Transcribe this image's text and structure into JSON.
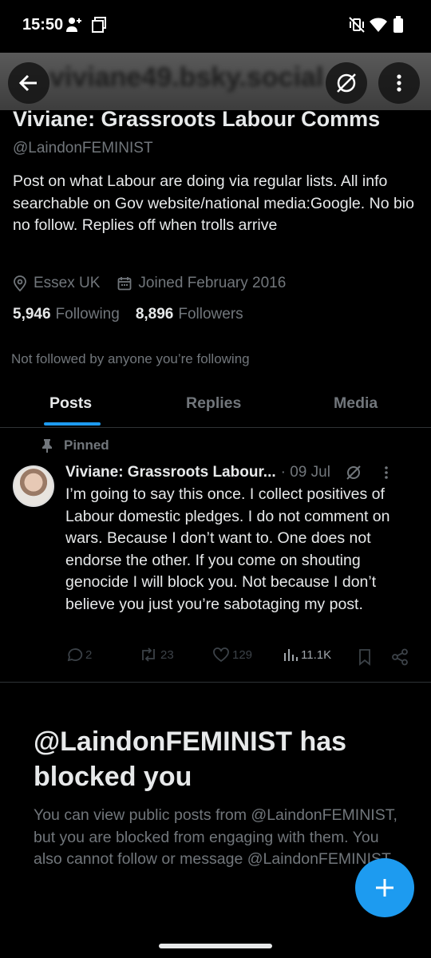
{
  "status_bar": {
    "time": "15:50",
    "icons": [
      "person-add-icon",
      "screen-square-icon",
      "vibrate-off-icon",
      "wifi-icon",
      "battery-icon"
    ]
  },
  "banner": {
    "blurred_handle": "viviane49.bsky.social"
  },
  "profile": {
    "display_name": "Viviane: Grassroots Labour Comms",
    "handle": "@LaindonFEMINIST",
    "bio": "Post on what Labour are doing via regular lists. All info searchable on Gov website/national media:Google. No bio no follow. Replies off when trolls arrive",
    "location": "Essex UK",
    "joined": "Joined February 2016",
    "following_count": "5,946",
    "following_label": "Following",
    "followers_count": "8,896",
    "followers_label": "Followers",
    "not_followed": "Not followed by anyone you’re following"
  },
  "tabs": [
    {
      "label": "Posts",
      "active": true
    },
    {
      "label": "Replies",
      "active": false
    },
    {
      "label": "Media",
      "active": false
    }
  ],
  "pinned_post": {
    "pinned_label": "Pinned",
    "author": "Viviane: Grassroots Labour...",
    "date": "· 09 Jul",
    "text": "I’m going to say this once. I collect positives of Labour domestic pledges. I do not comment on wars. Because I don’t want to. One does not endorse the other. If you come on shouting genocide I will block you. Not because I don’t believe you just you’re sabotaging my post.",
    "replies": "2",
    "reposts": "23",
    "likes": "129",
    "views": "11.1K"
  },
  "blocked": {
    "title": "@LaindonFEMINIST has blocked you",
    "description": "You can view public posts from @LaindonFEMINIST, but you are blocked from engaging with them. You also cannot follow or message @LaindonFEMINIST."
  },
  "colors": {
    "background": "#000000",
    "primary_text": "#e7e9ea",
    "secondary_text": "#71767b",
    "accent": "#1d9bf0",
    "divider": "#2f3336"
  }
}
